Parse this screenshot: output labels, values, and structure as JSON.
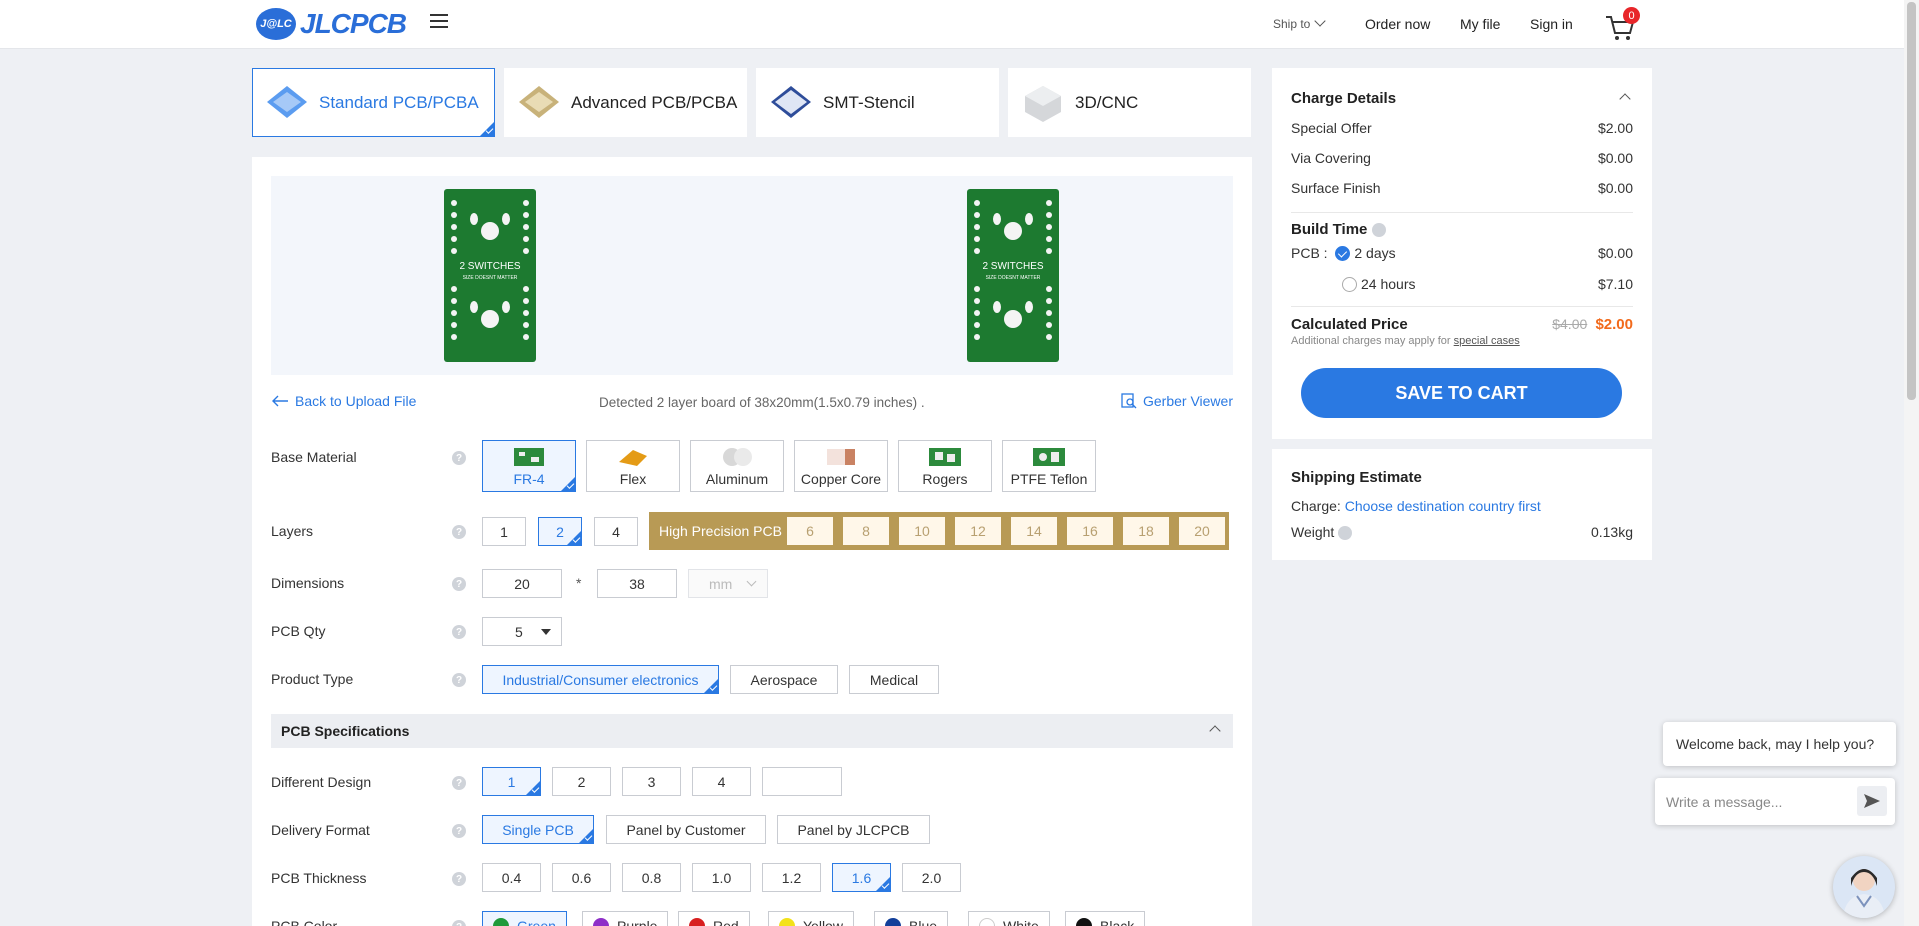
{
  "header": {
    "logo_badge": "J@LC",
    "logo_text": "JLCPCB",
    "ship_to": "Ship to",
    "order_now": "Order now",
    "my_file": "My file",
    "sign_in": "Sign in",
    "cart_count": "0"
  },
  "tabs": [
    {
      "label": "Standard PCB/PCBA"
    },
    {
      "label": "Advanced PCB/PCBA"
    },
    {
      "label": "SMT-Stencil"
    },
    {
      "label": "3D/CNC"
    }
  ],
  "preview": {
    "back_label": "Back to Upload File",
    "detected": "Detected 2 layer board of 38x20mm(1.5x0.79 inches) .",
    "gerber_label": "Gerber Viewer"
  },
  "form": {
    "base_material": {
      "label": "Base Material",
      "options": [
        "FR-4",
        "Flex",
        "Aluminum",
        "Copper Core",
        "Rogers",
        "PTFE Teflon"
      ]
    },
    "layers": {
      "label": "Layers",
      "options": [
        "1",
        "2",
        "4"
      ],
      "high_precision_label": "High Precision PCB",
      "high_precision_options": [
        "6",
        "8",
        "10",
        "12",
        "14",
        "16",
        "18",
        "20"
      ]
    },
    "dimensions": {
      "label": "Dimensions",
      "width": "20",
      "times": "*",
      "height": "38",
      "unit": "mm"
    },
    "qty": {
      "label": "PCB Qty",
      "value": "5"
    },
    "product_type": {
      "label": "Product Type",
      "options": [
        "Industrial/Consumer electronics",
        "Aerospace",
        "Medical"
      ]
    },
    "section_title": "PCB Specifications",
    "different_design": {
      "label": "Different Design",
      "options": [
        "1",
        "2",
        "3",
        "4",
        ""
      ]
    },
    "delivery_format": {
      "label": "Delivery Format",
      "options": [
        "Single PCB",
        "Panel by Customer",
        "Panel by JLCPCB"
      ]
    },
    "thickness": {
      "label": "PCB Thickness",
      "options": [
        "0.4",
        "0.6",
        "0.8",
        "1.0",
        "1.2",
        "1.6",
        "2.0"
      ]
    },
    "color": {
      "label": "PCB Color",
      "options": [
        {
          "name": "Green",
          "color": "#1f9a3a"
        },
        {
          "name": "Purple",
          "color": "#8e2fc8"
        },
        {
          "name": "Red",
          "color": "#d82020"
        },
        {
          "name": "Yellow",
          "color": "#f3e21a"
        },
        {
          "name": "Blue",
          "color": "#123f9a"
        },
        {
          "name": "White",
          "color": "#ffffff"
        },
        {
          "name": "Black",
          "color": "#111111"
        }
      ]
    }
  },
  "charge": {
    "title": "Charge Details",
    "rows": [
      {
        "label": "Special Offer",
        "value": "$2.00"
      },
      {
        "label": "Via Covering",
        "value": "$0.00"
      },
      {
        "label": "Surface Finish",
        "value": "$0.00"
      }
    ],
    "build_time_title": "Build Time",
    "pcb_label": "PCB :",
    "build_options": [
      {
        "label": "2 days",
        "value": "$0.00"
      },
      {
        "label": "24 hours",
        "value": "$7.10"
      }
    ],
    "calculated_label": "Calculated Price",
    "old_price": "$4.00",
    "new_price": "$2.00",
    "note": "Additional charges may apply for",
    "note_link": "special cases",
    "save_label": "SAVE TO CART"
  },
  "shipping": {
    "title": "Shipping Estimate",
    "charge_label": "Charge:",
    "charge_link": "Choose destination country first",
    "weight_label": "Weight",
    "weight_value": "0.13kg"
  },
  "chat": {
    "welcome": "Welcome back, may I help you?",
    "placeholder": "Write a message..."
  },
  "board_text": {
    "line1": "2 SWITCHES",
    "line2": "SIZE DOESNT MATTER"
  }
}
